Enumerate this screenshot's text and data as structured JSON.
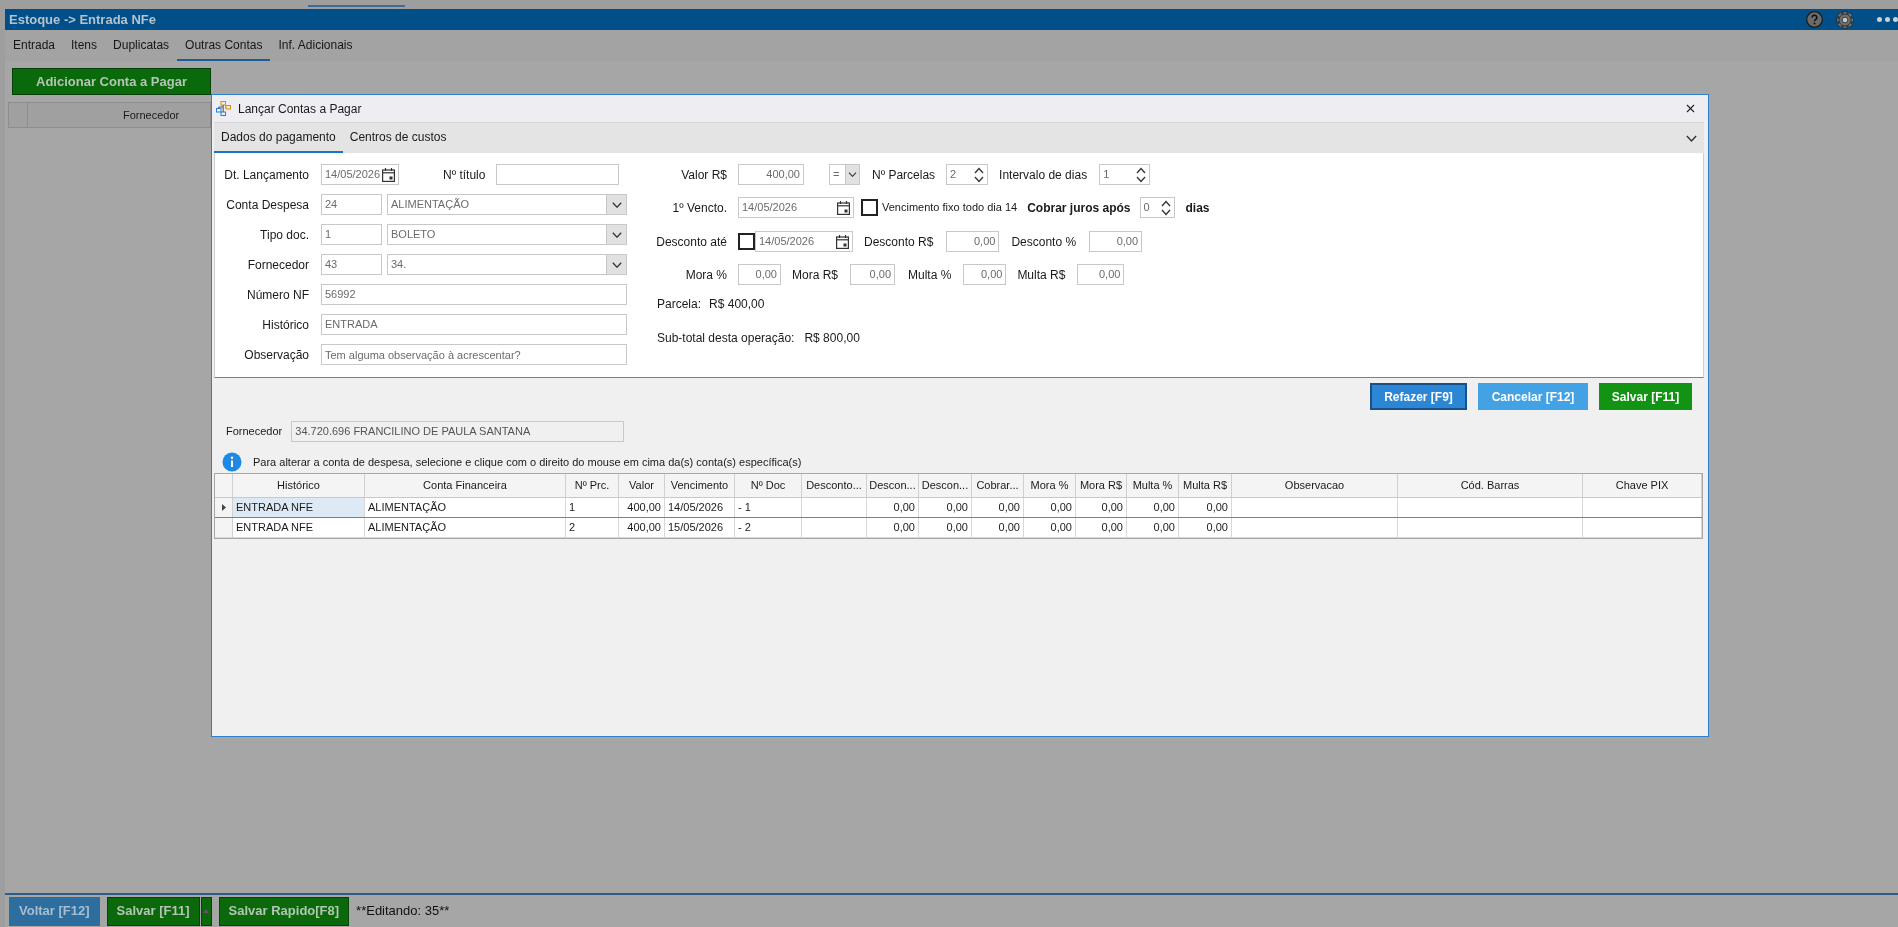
{
  "top_bar": {
    "title": "Estoque -> Entrada NFe"
  },
  "tabs": [
    {
      "label": "Entrada",
      "selected": false
    },
    {
      "label": "Itens",
      "selected": false
    },
    {
      "label": "Duplicatas",
      "selected": false
    },
    {
      "label": "Outras Contas",
      "selected": true
    },
    {
      "label": "Inf. Adicionais",
      "selected": false
    }
  ],
  "add_button": {
    "label": "Adicionar Conta a Pagar"
  },
  "background_table": {
    "columns": [
      "Fornecedor"
    ]
  },
  "dialog": {
    "title": "Lançar Contas a Pagar",
    "tabs": [
      {
        "label": "Dados do pagamento",
        "selected": true
      },
      {
        "label": "Centros de custos",
        "selected": false
      }
    ],
    "left_form": [
      {
        "kind": "date",
        "label": "Dt. Lançamento",
        "value": "14/05/2026",
        "extra": {
          "label": "Nº título"
        }
      },
      {
        "kind": "lookup",
        "label": "Conta Despesa",
        "code": "24",
        "value": "ALIMENTAÇÃO"
      },
      {
        "kind": "lookup",
        "label": "Tipo doc.",
        "code": "1",
        "value": "BOLETO"
      },
      {
        "kind": "lookup",
        "label": "Fornecedor",
        "code": "43",
        "value": "34."
      },
      {
        "kind": "text",
        "label": "Número NF",
        "value": "56992"
      },
      {
        "kind": "text",
        "label": "Histórico",
        "value": "ENTRADA"
      },
      {
        "kind": "text",
        "label": "Observação",
        "placeholder": "Tem alguma observação à acrescentar?"
      }
    ],
    "payment": {
      "valor": {
        "label": "Valor R$",
        "value": "400,00"
      },
      "operator": {
        "value": "="
      },
      "parcelas": {
        "label": "Nº Parcelas",
        "value": "2"
      },
      "intervalo": {
        "label": "Intervalo de dias",
        "value": "1"
      },
      "primeiro_vencto": {
        "label": "1º Vencto.",
        "value": "14/05/2026"
      },
      "vencimento_fixo": {
        "label": "Vencimento fixo todo dia 14",
        "checked": false
      },
      "cobrar_juros": {
        "label": "Cobrar juros após",
        "value": "0",
        "unit": "dias"
      },
      "desconto_ate": {
        "label": "Desconto até",
        "checked": false,
        "value": "14/05/2026"
      },
      "desconto_valor": {
        "label": "Desconto R$",
        "value": "0,00"
      },
      "desconto_percent": {
        "label": "Desconto %",
        "value": "0,00"
      },
      "mora_percent": {
        "label": "Mora %",
        "value": "0,00"
      },
      "mora_valor": {
        "label": "Mora R$",
        "value": "0,00"
      },
      "multa_percent": {
        "label": "Multa %",
        "value": "0,00"
      },
      "multa_valor": {
        "label": "Multa R$",
        "value": "0,00"
      },
      "parcela": {
        "label": "Parcela:",
        "value": "R$ 400,00"
      },
      "subtotal": {
        "label": "Sub-total desta operação:",
        "value": "R$ 800,00"
      }
    },
    "actions": [
      {
        "label": "Refazer [F9]",
        "kind": "primary"
      },
      {
        "label": "Cancelar [F12]",
        "kind": "secondary"
      },
      {
        "label": "Salvar [F11]",
        "kind": "success"
      }
    ],
    "fornecedor": {
      "label": "Fornecedor",
      "value": "34.720.696 FRANCILINO DE PAULA SANTANA"
    },
    "info": "Para alterar a conta de despesa, selecione e clique com o direito do mouse em cima da(s) conta(s) específica(s)",
    "table": {
      "columns": [
        "Histórico",
        "Conta Financeira",
        "Nº Prc.",
        "Valor",
        "Vencimento",
        "Nº Doc",
        "Desconto...",
        "Descon...",
        "Descon...",
        "Cobrar...",
        "Mora %",
        "Mora R$",
        "Multa %",
        "Multa R$",
        "Observacao",
        "Cód. Barras",
        "Chave PIX"
      ],
      "rows": [
        {
          "selected": true,
          "cells": [
            "ENTRADA NFE",
            "ALIMENTAÇÃO",
            "1",
            "400,00",
            "14/05/2026",
            "- 1",
            null,
            "0,00",
            "0,00",
            "0,00",
            "0,00",
            "0,00",
            "0,00",
            "0,00",
            null,
            null,
            null
          ]
        },
        {
          "selected": false,
          "cells": [
            "ENTRADA NFE",
            "ALIMENTAÇÃO",
            "2",
            "400,00",
            "15/05/2026",
            "- 2",
            null,
            "0,00",
            "0,00",
            "0,00",
            "0,00",
            "0,00",
            "0,00",
            "0,00",
            null,
            null,
            null
          ]
        }
      ]
    }
  },
  "bottom_bar": {
    "buttons": [
      {
        "label": "Voltar [F12]",
        "kind": "back",
        "split": false
      },
      {
        "label": "Salvar [F11]",
        "kind": "save",
        "split": true
      },
      {
        "label": "Salvar Rapido[F8]",
        "kind": "save",
        "split": false
      }
    ],
    "status": "**Editando: 35**"
  }
}
